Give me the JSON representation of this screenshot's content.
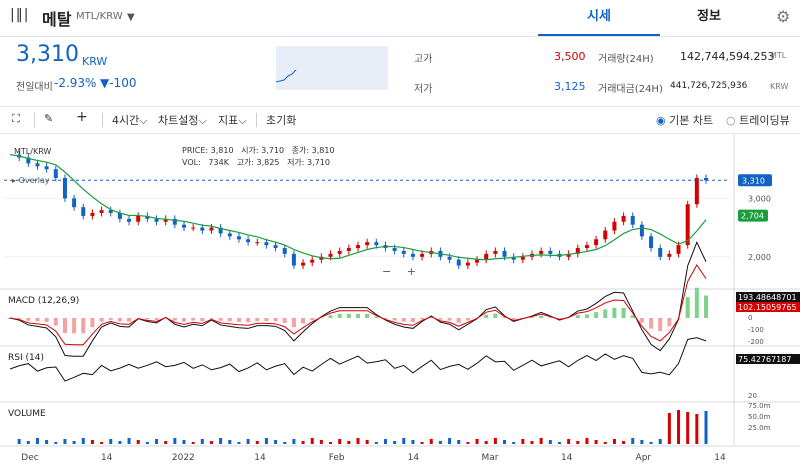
{
  "header": {
    "logo_text": "|‖|",
    "coin_name": "메탈",
    "pair": "MTL/KRW",
    "tabs": [
      "시세",
      "정보"
    ]
  },
  "price": {
    "current": "3,310",
    "unit": "KRW",
    "change_label": "전일대비",
    "change_pct": "-2.93%",
    "change_val": "▼-100"
  },
  "stats": {
    "high_label": "고가",
    "high": "3,500",
    "low_label": "저가",
    "low": "3,125",
    "volume_label": "거래량(24H)",
    "volume": "142,744,594.253",
    "volume_unit": "MTL",
    "amount_label": "거래대금(24H)",
    "amount": "441,726,725,936",
    "amount_unit": "KRW"
  },
  "toolbar": {
    "interval": "4시간",
    "chart_settings": "차트설정",
    "indicators": "지표",
    "reset": "초기화",
    "basic_chart": "기본 차트",
    "tradingview": "트레이딩뷰"
  },
  "chart_data": {
    "type": "candlestick",
    "title": "MTL/KRW",
    "overlay_label": "Overlay",
    "ohlc_info": {
      "PRICE": "3,810",
      "시가": "3,710",
      "종가": "3,810",
      "VOL": "734K",
      "고가": "3,825",
      "저가": "3,710"
    },
    "price_ticks": [
      "3,000",
      "2,000"
    ],
    "last_price": "3,310",
    "ma_price": "2,704",
    "macd": {
      "label": "MACD (12,26,9)",
      "value1": "193.48648701",
      "value2": "102.15059765",
      "ticks": [
        "0",
        "-100",
        "-200"
      ]
    },
    "rsi": {
      "label": "RSI (14)",
      "value": "75.42767187",
      "ticks": [
        "20"
      ]
    },
    "volume": {
      "label": "VOLUME",
      "ticks": [
        "75.0m",
        "50.0m",
        "25.0m"
      ]
    },
    "x_ticks": [
      "Dec",
      "14",
      "2022",
      "14",
      "Feb",
      "14",
      "Mar",
      "14",
      "Apr",
      "14"
    ],
    "colors": {
      "up": "#d60000",
      "down": "#1261c4",
      "ma": "#1a9e3c",
      "last": "#1261c4"
    },
    "close": [
      3750,
      3700,
      3600,
      3550,
      3500,
      3350,
      3000,
      2850,
      2700,
      2750,
      2800,
      2750,
      2650,
      2600,
      2700,
      2650,
      2600,
      2650,
      2550,
      2500,
      2500,
      2450,
      2500,
      2400,
      2350,
      2300,
      2250,
      2250,
      2200,
      2150,
      2050,
      1850,
      1900,
      1950,
      2000,
      2050,
      2100,
      2150,
      2200,
      2250,
      2200,
      2150,
      2100,
      2050,
      2000,
      2050,
      2100,
      2000,
      1950,
      1850,
      1900,
      1950,
      2050,
      2100,
      2000,
      1950,
      2000,
      2050,
      2100,
      2050,
      2000,
      2050,
      2150,
      2200,
      2300,
      2450,
      2600,
      2700,
      2550,
      2350,
      2150,
      2000,
      2050,
      2200,
      2900,
      3350,
      3310
    ]
  }
}
